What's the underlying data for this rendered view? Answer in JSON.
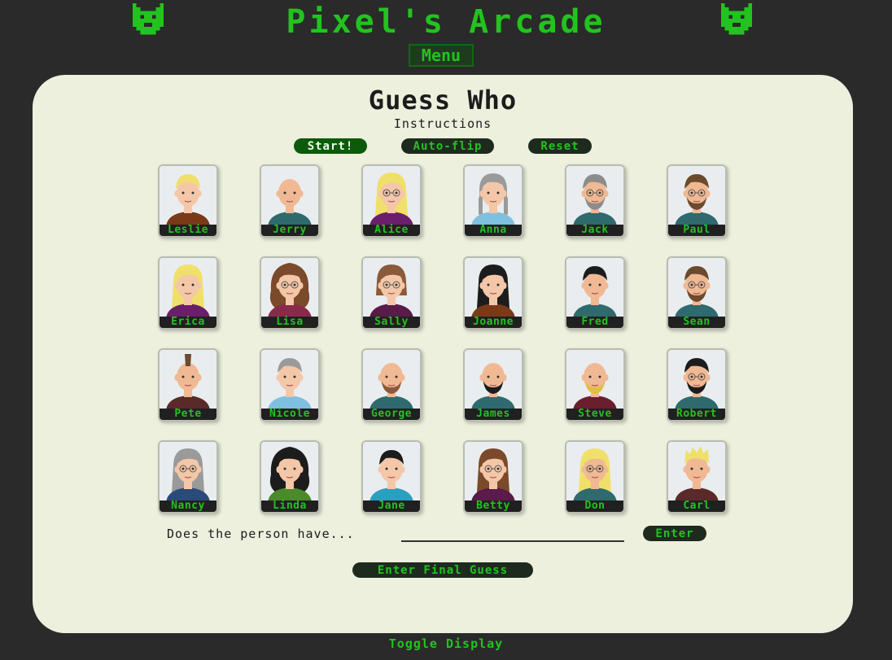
{
  "header": {
    "title": "Pixel's Arcade",
    "menu_label": "Menu"
  },
  "game": {
    "title": "Guess Who",
    "instructions_label": "Instructions",
    "buttons": {
      "start": "Start!",
      "autoflip": "Auto-flip",
      "reset": "Reset"
    },
    "question_label": "Does the person have...",
    "question_placeholder": "",
    "enter_label": "Enter",
    "final_guess_label": "Enter Final Guess"
  },
  "characters": [
    {
      "name": "Leslie",
      "hair": "#f0e06a",
      "shirt": "#7a3a18",
      "skin": "#f4c7a8",
      "glasses": false,
      "beard": null,
      "style": "short"
    },
    {
      "name": "Jerry",
      "hair": null,
      "shirt": "#2f6a6e",
      "skin": "#f0b993",
      "glasses": false,
      "beard": null,
      "style": "bald"
    },
    {
      "name": "Alice",
      "hair": "#f0e06a",
      "shirt": "#6b1e6b",
      "skin": "#f4c7a8",
      "glasses": true,
      "beard": null,
      "style": "long"
    },
    {
      "name": "Anna",
      "hair": "#9a9a9a",
      "shirt": "#7fc0e0",
      "skin": "#f4c7a8",
      "glasses": false,
      "beard": null,
      "style": "braids"
    },
    {
      "name": "Jack",
      "hair": "#8c8c8c",
      "shirt": "#2f6a6e",
      "skin": "#f0b993",
      "glasses": true,
      "beard": "#8c8c8c",
      "style": "short"
    },
    {
      "name": "Paul",
      "hair": "#6b4a2e",
      "shirt": "#2f6a6e",
      "skin": "#f0b993",
      "glasses": true,
      "beard": "#6b4a2e",
      "style": "short"
    },
    {
      "name": "Erica",
      "hair": "#f0e06a",
      "shirt": "#6b1e6b",
      "skin": "#f4c7a8",
      "glasses": false,
      "beard": null,
      "style": "long"
    },
    {
      "name": "Lisa",
      "hair": "#7a4a2a",
      "shirt": "#8a2a4a",
      "skin": "#f4c7a8",
      "glasses": true,
      "beard": null,
      "style": "curly"
    },
    {
      "name": "Sally",
      "hair": "#8a5a3a",
      "shirt": "#5a1a4a",
      "skin": "#f4c7a8",
      "glasses": true,
      "beard": null,
      "style": "bob"
    },
    {
      "name": "Joanne",
      "hair": "#1c1c1c",
      "shirt": "#7a3a18",
      "skin": "#f4c7a8",
      "glasses": false,
      "beard": null,
      "style": "long"
    },
    {
      "name": "Fred",
      "hair": "#1c1c1c",
      "shirt": "#2f6a6e",
      "skin": "#f0b993",
      "glasses": false,
      "beard": null,
      "style": "short"
    },
    {
      "name": "Sean",
      "hair": "#6b4a2e",
      "shirt": "#2f6a6e",
      "skin": "#f0b993",
      "glasses": true,
      "beard": "#6b4a2e",
      "style": "short"
    },
    {
      "name": "Pete",
      "hair": "#6b4a2e",
      "shirt": "#5a2a2a",
      "skin": "#f0b993",
      "glasses": false,
      "beard": null,
      "style": "mohawk"
    },
    {
      "name": "Nicole",
      "hair": "#9a9a9a",
      "shirt": "#7fc0e0",
      "skin": "#f4c7a8",
      "glasses": false,
      "beard": null,
      "style": "short"
    },
    {
      "name": "George",
      "hair": null,
      "shirt": "#2f6a6e",
      "skin": "#f0b993",
      "glasses": false,
      "beard": "#8a5a3a",
      "style": "bald"
    },
    {
      "name": "James",
      "hair": null,
      "shirt": "#2f6a6e",
      "skin": "#f0b993",
      "glasses": false,
      "beard": "#1c1c1c",
      "style": "bald"
    },
    {
      "name": "Steve",
      "hair": null,
      "shirt": "#6b1e2e",
      "skin": "#f0b993",
      "glasses": false,
      "beard": "#e0c040",
      "style": "bald"
    },
    {
      "name": "Robert",
      "hair": "#1c1c1c",
      "shirt": "#2f6a6e",
      "skin": "#f0b993",
      "glasses": true,
      "beard": "#1c1c1c",
      "style": "short"
    },
    {
      "name": "Nancy",
      "hair": "#9a9a9a",
      "shirt": "#2a4a7a",
      "skin": "#f4c7a8",
      "glasses": true,
      "beard": null,
      "style": "long"
    },
    {
      "name": "Linda",
      "hair": "#1c1c1c",
      "shirt": "#4a8a2a",
      "skin": "#f4c7a8",
      "glasses": false,
      "beard": null,
      "style": "curly"
    },
    {
      "name": "Jane",
      "hair": "#1c1c1c",
      "shirt": "#2aa0c0",
      "skin": "#f4c7a8",
      "glasses": false,
      "beard": null,
      "style": "short"
    },
    {
      "name": "Betty",
      "hair": "#7a4a2a",
      "shirt": "#5a1a4a",
      "skin": "#f4c7a8",
      "glasses": true,
      "beard": null,
      "style": "long"
    },
    {
      "name": "Don",
      "hair": "#f0e06a",
      "shirt": "#2f6a6e",
      "skin": "#f0b993",
      "glasses": true,
      "beard": null,
      "style": "long"
    },
    {
      "name": "Carl",
      "hair": "#f0e06a",
      "shirt": "#5a2a2a",
      "skin": "#f0b993",
      "glasses": false,
      "beard": null,
      "style": "spiky"
    }
  ],
  "footer": {
    "toggle_label": "Toggle Display"
  }
}
